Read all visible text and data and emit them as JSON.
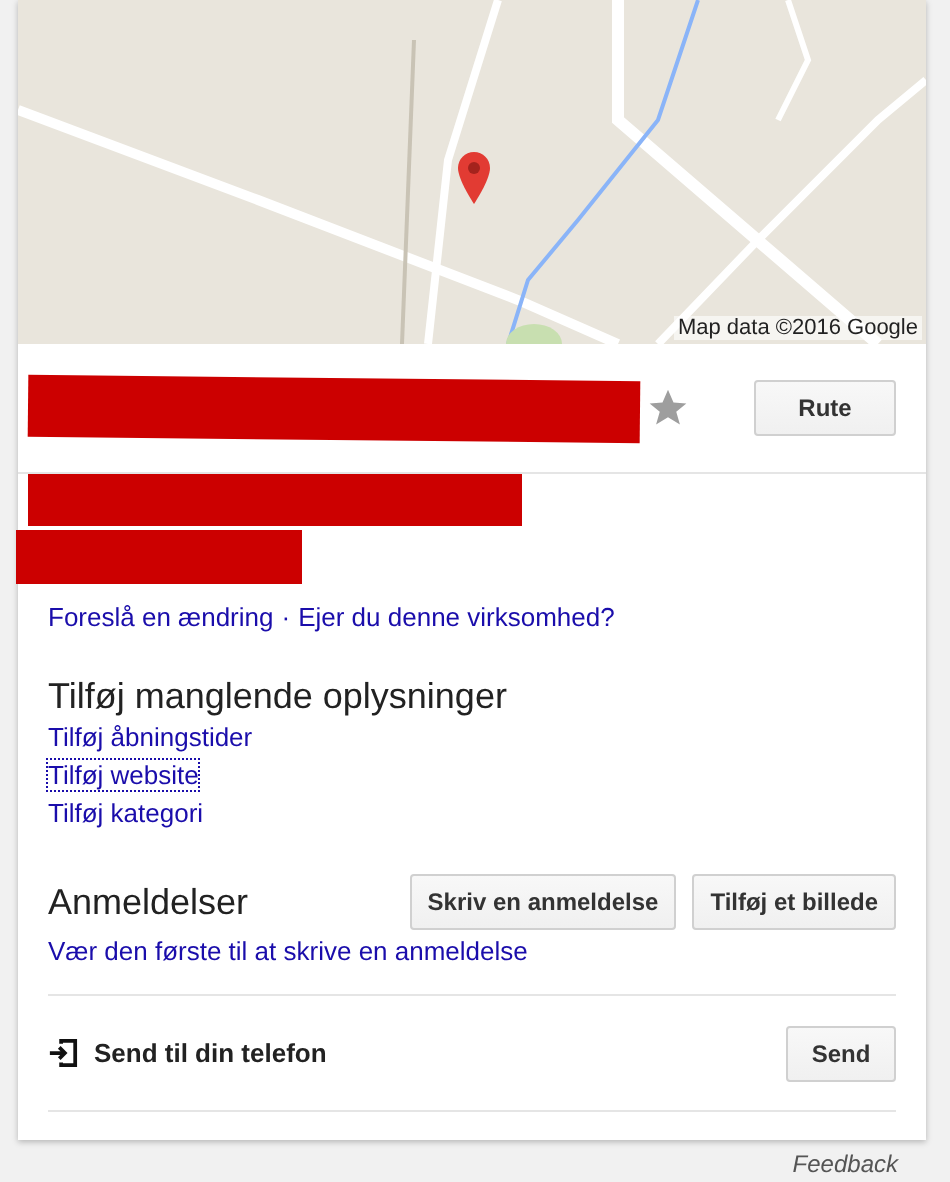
{
  "map": {
    "attribution": "Map data ©2016 Google"
  },
  "header": {
    "saved": false,
    "route_button": "Rute"
  },
  "edit_links": [
    {
      "label": "Foreslå en ændring"
    },
    {
      "label": "Ejer du denne virksomhed?"
    }
  ],
  "edit_separator": "·",
  "missing_info": {
    "heading": "Tilføj manglende oplysninger",
    "links": [
      {
        "label": "Tilføj åbningstider",
        "focused": false
      },
      {
        "label": "Tilføj website",
        "focused": true
      },
      {
        "label": "Tilføj kategori",
        "focused": false
      }
    ]
  },
  "reviews": {
    "heading": "Anmeldelser",
    "buttons": [
      "Skriv en anmeldelse",
      "Tilføj et billede"
    ],
    "link": "Vær den første til at skrive en anmeldelse"
  },
  "send": {
    "label": "Send til din telefon",
    "button": "Send"
  },
  "feedback": "Feedback"
}
